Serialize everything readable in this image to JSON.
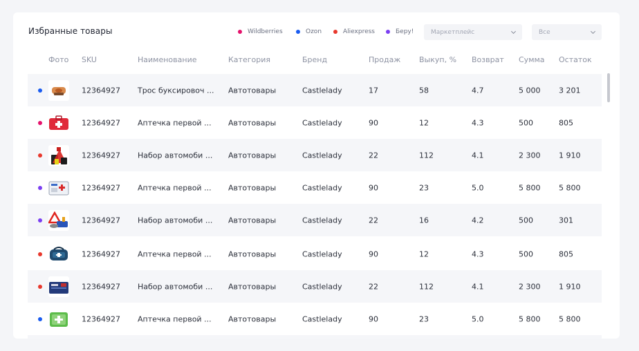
{
  "title": "Избранные товары",
  "legend": [
    {
      "label": "Wildberries",
      "color": "#e5126c"
    },
    {
      "label": "Ozon",
      "color": "#1a5cf0"
    },
    {
      "label": "Aliexpress",
      "color": "#e8382d"
    },
    {
      "label": "Беру!",
      "color": "#7b3ff2"
    }
  ],
  "filters": {
    "marketplace": "Маркетплейс",
    "all": "Все"
  },
  "columns": [
    "Фото",
    "SKU",
    "Наименование",
    "Категория",
    "Бренд",
    "Продаж",
    "Выкуп, %",
    "Возврат",
    "Сумма",
    "Остаток"
  ],
  "rows": [
    {
      "color": "#1a5cf0",
      "icon": "tow-rope-icon",
      "sku": "12364927",
      "name": "Трос буксировоч ...",
      "category": "Автотовары",
      "brand": "Castlelady",
      "sales": "17",
      "buyout": "58",
      "returns": "4.7",
      "sum": "5 000",
      "stock": "3 201"
    },
    {
      "color": "#e5126c",
      "icon": "first-aid-kit-icon",
      "sku": "12364927",
      "name": "Аптечка первой ...",
      "category": "Автотовары",
      "brand": "Castlelady",
      "sales": "90",
      "buyout": "12",
      "returns": "4.3",
      "sum": "500",
      "stock": "805"
    },
    {
      "color": "#e8382d",
      "icon": "car-kit-icon",
      "sku": "12364927",
      "name": "Набор автомоби ...",
      "category": "Автотовары",
      "brand": "Castlelady",
      "sales": "22",
      "buyout": "112",
      "returns": "4.1",
      "sum": "2 300",
      "stock": "1 910"
    },
    {
      "color": "#7b3ff2",
      "icon": "first-aid-box-icon",
      "sku": "12364927",
      "name": "Аптечка первой ...",
      "category": "Автотовары",
      "brand": "Castlelady",
      "sales": "90",
      "buyout": "23",
      "returns": "5.0",
      "sum": "5 800",
      "stock": "5 800"
    },
    {
      "color": "#7b3ff2",
      "icon": "warning-triangle-icon",
      "sku": "12364927",
      "name": "Набор автомоби ...",
      "category": "Автотовары",
      "brand": "Castlelady",
      "sales": "22",
      "buyout": "16",
      "returns": "4.2",
      "sum": "500",
      "stock": "301"
    },
    {
      "color": "#e8382d",
      "icon": "first-aid-bag-icon",
      "sku": "12364927",
      "name": "Аптечка первой ...",
      "category": "Автотовары",
      "brand": "Castlelady",
      "sales": "90",
      "buyout": "12",
      "returns": "4.3",
      "sum": "500",
      "stock": "805"
    },
    {
      "color": "#e8382d",
      "icon": "car-bag-icon",
      "sku": "12364927",
      "name": "Набор автомоби ...",
      "category": "Автотовары",
      "brand": "Castlelady",
      "sales": "22",
      "buyout": "112",
      "returns": "4.1",
      "sum": "2 300",
      "stock": "1 910"
    },
    {
      "color": "#1a5cf0",
      "icon": "first-aid-green-icon",
      "sku": "12364927",
      "name": "Аптечка первой ...",
      "category": "Автотовары",
      "brand": "Castlelady",
      "sales": "90",
      "buyout": "23",
      "returns": "5.0",
      "sum": "5 800",
      "stock": "5 800"
    }
  ]
}
